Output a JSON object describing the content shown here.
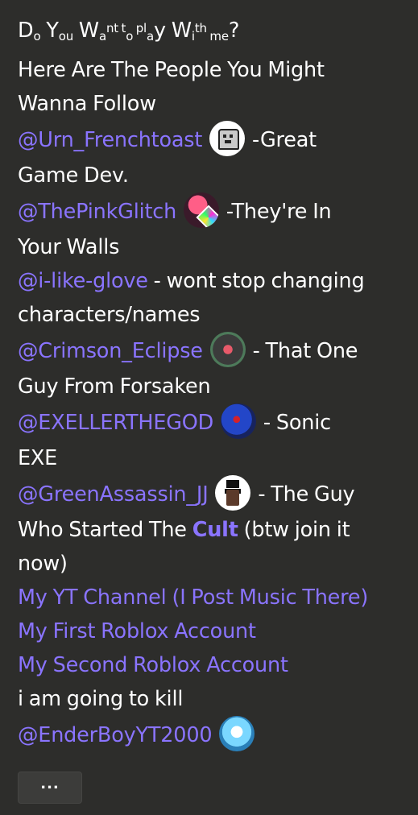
{
  "bio": {
    "title_parts": [
      "D",
      "o",
      " Y",
      "ou",
      " W",
      "a",
      "nt",
      " t",
      "o",
      " pl",
      "a",
      "y",
      " W",
      "i",
      "th",
      " m",
      "e",
      "?"
    ],
    "intro": "Here Are The People You Might",
    "intro2": "Wanna Follow",
    "people": [
      {
        "handle": "@Urn_Frenchtoast",
        "desc1": " -Great",
        "desc2": "Game Dev."
      },
      {
        "handle": "@ThePinkGlitch",
        "desc1": " -They're In",
        "desc2": "Your Walls"
      },
      {
        "handle": "@i-like-glove",
        "desc1": " - wont stop changing",
        "desc2": "characters/names"
      },
      {
        "handle": "@Crimson_Eclipse",
        "desc1": " - That One",
        "desc2": "Guy From Forsaken"
      },
      {
        "handle": "@EXELLERTHEGOD",
        "desc1": " - Sonic",
        "desc2": "EXE"
      },
      {
        "handle": "@GreenAssassin_JJ",
        "desc1": " - The Guy",
        "desc2a": "Who Started The ",
        "cult": "Cult",
        "desc2b": " (btw join it",
        "desc3": "now)"
      }
    ],
    "links": [
      "My YT Channel (I Post Music There)",
      "My First Roblox Account",
      "My Second Roblox Account"
    ],
    "outro": "i am going to kill",
    "final_handle": "@EnderBoyYT2000"
  },
  "more_button": "...",
  "colors": {
    "background": "#2d2d2b",
    "text": "#ffffff",
    "link": "#8a74ff"
  }
}
